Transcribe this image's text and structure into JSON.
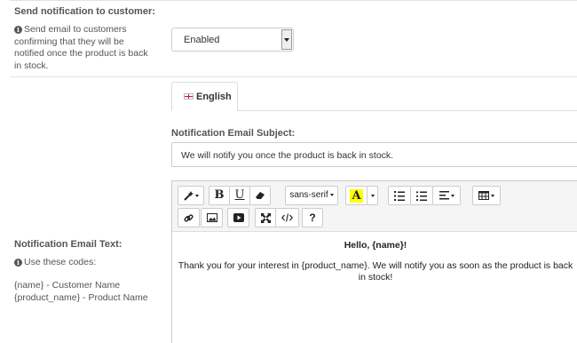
{
  "notification": {
    "label": "Send notification to customer:",
    "help": "Send email to customers confirming that they will be notified once the product is back in stock.",
    "help_lines": [
      "Send email to customers",
      "confirming that they will be",
      "notified once the product is back",
      "in stock."
    ],
    "select_value": "Enabled"
  },
  "tabs": [
    {
      "label": "English",
      "icon": "uk-flag-icon"
    }
  ],
  "subject": {
    "label": "Notification Email Subject:",
    "value": "We will notify you once the product is back in stock."
  },
  "email_text": {
    "label": "Notification Email Text:",
    "help": "Use these codes:",
    "codes": [
      "{name} - Customer Name",
      "{product_name} - Product Name"
    ]
  },
  "toolbar": {
    "font_name": "sans-serif",
    "bold": "B",
    "underline": "U",
    "help": "?",
    "buttons": [
      "magic-wand",
      "bold",
      "underline",
      "eraser",
      "font-name",
      "font-color",
      "ordered-list",
      "unordered-list",
      "paragraph-align",
      "table",
      "link",
      "picture",
      "video",
      "fullscreen",
      "code-view",
      "help"
    ]
  },
  "editor": {
    "greeting": "Hello, {name}!",
    "message": "Thank you for your interest in {product_name}. We will notify you as soon as the product is back in stock!"
  },
  "colors": {
    "font_color_highlight": "#ffff00",
    "border": "#cccccc",
    "toolbar_bg": "#f5f5f5"
  }
}
